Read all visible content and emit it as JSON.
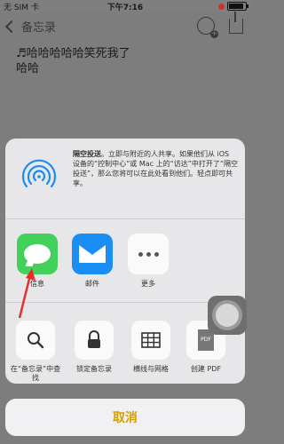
{
  "status_bar": {
    "carrier": "无 SIM 卡",
    "time": "下午7:16",
    "battery_level": 0.85
  },
  "nav": {
    "back_label": "备忘录"
  },
  "note": {
    "line1": "♬哈哈哈哈哈笑死我了",
    "line2": "哈哈"
  },
  "airdrop": {
    "title": "隔空投送",
    "description": "。立即与附近的人共享。如果他们从 iOS 设备的“控制中心”或 Mac 上的“访达”中打开了“隔空投送”，那么您将可以在此处看到他们。轻点即可共享。"
  },
  "apps": [
    {
      "label": "信息",
      "icon": "messages-icon"
    },
    {
      "label": "邮件",
      "icon": "mail-icon"
    },
    {
      "label": "更多",
      "icon": "more-icon"
    }
  ],
  "actions": [
    {
      "label": "在“备忘录”中查找",
      "icon": "search-icon"
    },
    {
      "label": "锁定备忘录",
      "icon": "lock-icon"
    },
    {
      "label": "横线与网格",
      "icon": "grid-icon"
    },
    {
      "label": "创建 PDF",
      "icon": "pdf-icon",
      "icon_text": "PDF"
    }
  ],
  "cancel_label": "取消",
  "colors": {
    "accent": "#d59f00",
    "messages_green": "#43d15b",
    "mail_blue": "#1b8ef5",
    "arrow_red": "#e5302a"
  }
}
